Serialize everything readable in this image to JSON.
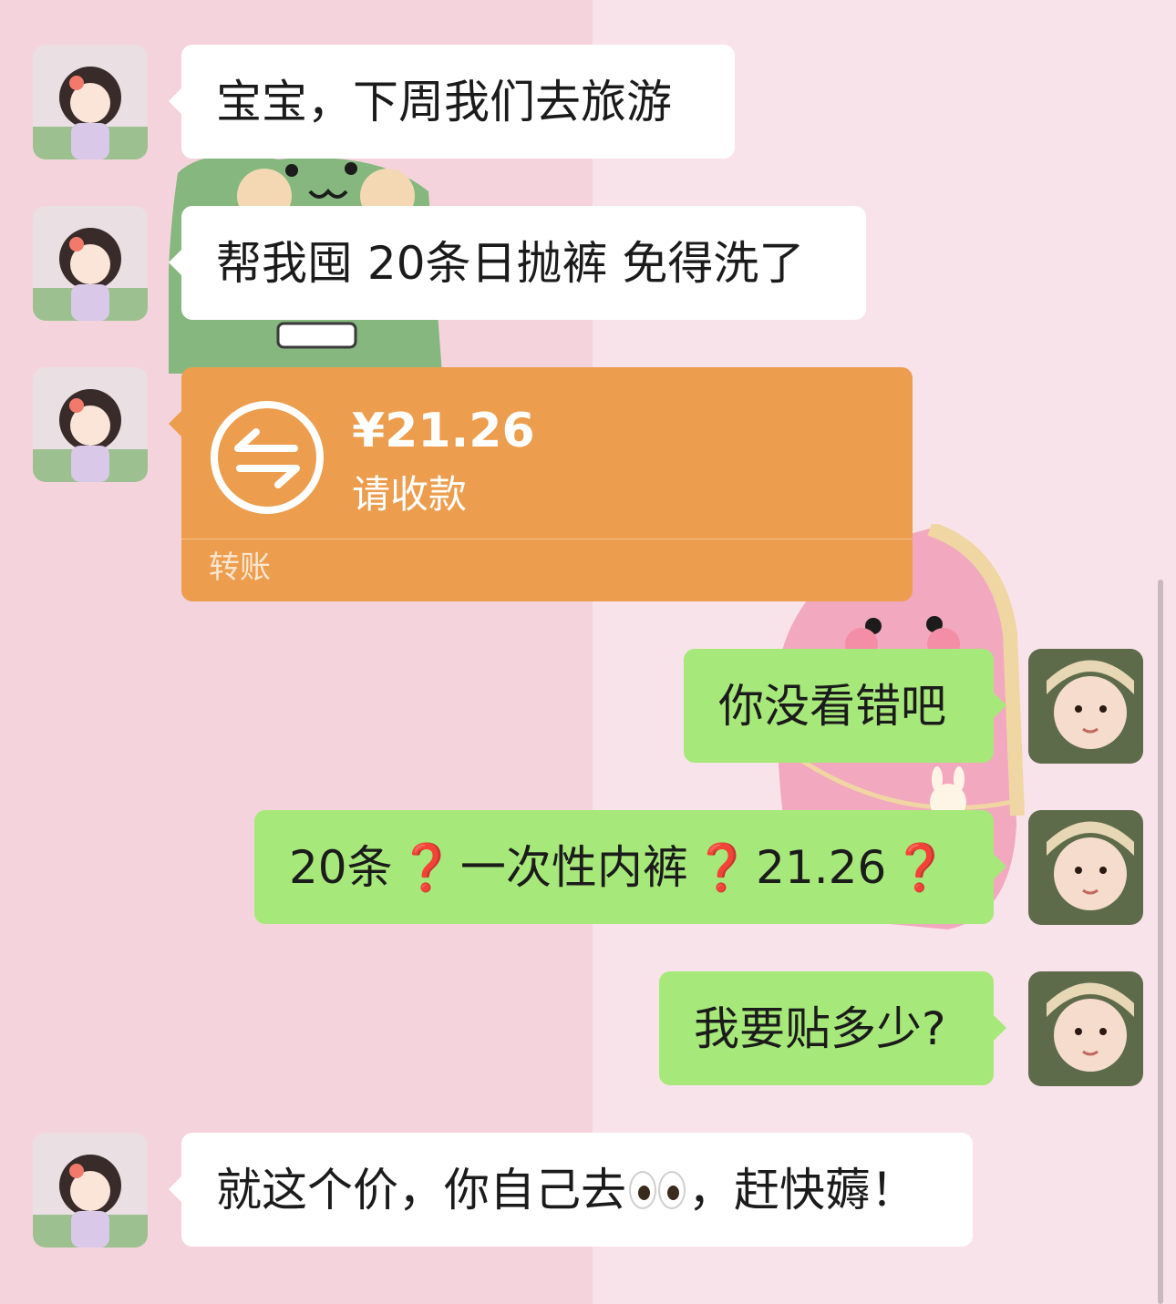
{
  "chat": {
    "messages": [
      {
        "side": "in",
        "text": "宝宝，下周我们去旅游"
      },
      {
        "side": "in",
        "text": "帮我囤 20条日抛裤 免得洗了"
      },
      {
        "side": "in",
        "type": "transfer",
        "amount": "¥21.26",
        "status": "请收款",
        "kind": "转账"
      },
      {
        "side": "out",
        "text": "你没看错吧"
      },
      {
        "side": "out",
        "parts": [
          "20条",
          "❓",
          "一次性内裤",
          "❓",
          "21.26",
          "❓"
        ]
      },
      {
        "side": "out",
        "text": "我要贴多少?"
      },
      {
        "side": "in",
        "parts": [
          "就这个价，你自己去",
          "👀",
          "，赶快薅！"
        ]
      }
    ]
  },
  "icons": {
    "transfer": "transfer-arrows-icon",
    "question": "red-question-mark",
    "eyes": "eyes-emoji"
  },
  "colors": {
    "bg_left": "#f5d3dc",
    "bg_right": "#f9e3ea",
    "incoming_bubble": "#ffffff",
    "outgoing_bubble": "#a7e87a",
    "transfer_card": "#ec9e4e",
    "question_mark": "#e13a2c"
  }
}
